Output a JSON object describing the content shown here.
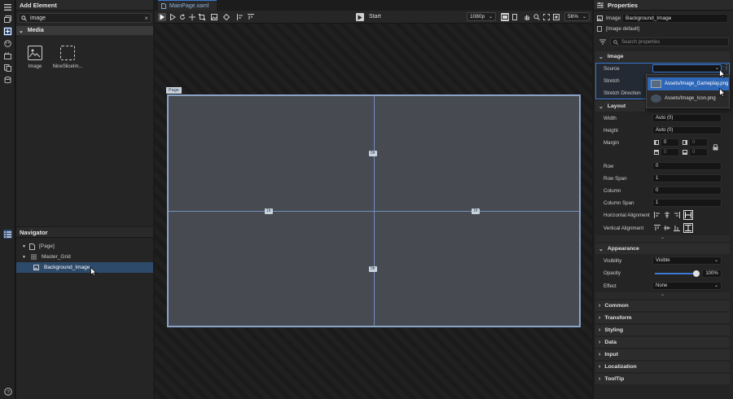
{
  "iconbar": {
    "icons": [
      "menu-icon",
      "pages-icon",
      "add-element-icon",
      "palette-icon",
      "media-icon",
      "copy-icon",
      "database-icon",
      "layers-icon",
      "help-icon"
    ]
  },
  "add_element": {
    "title": "Add Element",
    "search_value": "image",
    "category": "Media",
    "items": [
      {
        "label": "Image",
        "icon": "image-icon"
      },
      {
        "label": "NineSliceIm...",
        "icon": "nine-slice-icon"
      }
    ]
  },
  "navigator": {
    "title": "Navigator",
    "items": [
      {
        "label": "[Page]",
        "level": 0,
        "icon": "page-icon"
      },
      {
        "label": "Master_Grid",
        "level": 1,
        "icon": "grid-icon"
      },
      {
        "label": "Background_Image",
        "level": 2,
        "icon": "image-icon",
        "selected": true
      }
    ]
  },
  "editor": {
    "tab": "MainPage.xaml",
    "start_label": "Start",
    "resolution": "1080p",
    "zoom": "56%",
    "page_label": "Page",
    "grid_markers": {
      "top": "5fr",
      "bottom": "5fr",
      "left": "1fr",
      "right": "1fr"
    }
  },
  "properties": {
    "title": "Properties",
    "element_type": "Image",
    "element_name": "Background_Image",
    "default_label": "[Image default]",
    "search_placeholder": "Search properties",
    "image": {
      "section": "Image",
      "source_label": "Source",
      "stretch_label": "Stretch",
      "stretch_dir_label": "Stretch Direction",
      "dropdown_options": [
        "Assets/Image_Gameplay.png",
        "Assets/Image_Icon.png"
      ]
    },
    "layout": {
      "section": "Layout",
      "width_label": "Width",
      "width_value": "Auto (0)",
      "height_label": "Height",
      "height_value": "Auto (0)",
      "margin_label": "Margin",
      "margin_values": [
        "0",
        "0",
        "0",
        "0"
      ],
      "row_label": "Row",
      "row_value": "0",
      "rowspan_label": "Row Span",
      "rowspan_value": "1",
      "column_label": "Column",
      "column_value": "0",
      "colspan_label": "Column Span",
      "colspan_value": "1",
      "halign_label": "Horizontal Alignment",
      "valign_label": "Vertical Alignment"
    },
    "appearance": {
      "section": "Appearance",
      "visibility_label": "Visibility",
      "visibility_value": "Visible",
      "opacity_label": "Opacity",
      "opacity_value": "100%",
      "opacity_fraction": 1.0,
      "effect_label": "Effect",
      "effect_value": "None"
    },
    "collapsed_sections": [
      "Common",
      "Transform",
      "Styling",
      "Data",
      "Input",
      "Localization",
      "ToolTip"
    ]
  },
  "colors": {
    "accent": "#3b7bd6",
    "selection": "#2d4a6a",
    "page_border": "#8aa4c8"
  }
}
